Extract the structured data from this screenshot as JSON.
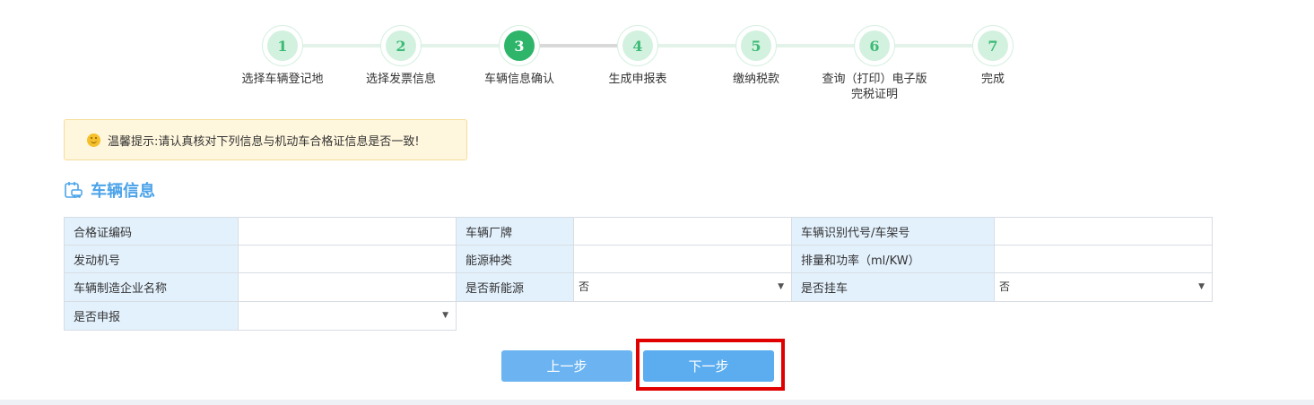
{
  "steps": [
    {
      "num": "1",
      "label": "选择车辆登记地"
    },
    {
      "num": "2",
      "label": "选择发票信息"
    },
    {
      "num": "3",
      "label": "车辆信息确认"
    },
    {
      "num": "4",
      "label": "生成申报表"
    },
    {
      "num": "5",
      "label": "缴纳税款"
    },
    {
      "num": "6",
      "label": "查询（打印）电子版完税证明"
    },
    {
      "num": "7",
      "label": "完成"
    }
  ],
  "active_step": 3,
  "tip": {
    "text": "温馨提示:请认真核对下列信息与机动车合格证信息是否一致!"
  },
  "section": {
    "title": "车辆信息"
  },
  "form": {
    "cert_no_label": "合格证编码",
    "cert_no_value": "",
    "brand_label": "车辆厂牌",
    "brand_value": "",
    "vin_label": "车辆识别代号/车架号",
    "vin_value": "",
    "engine_label": "发动机号",
    "engine_value": "",
    "energy_label": "能源种类",
    "energy_value": "",
    "displacement_label": "排量和功率（ml/KW）",
    "displacement_value": "",
    "manufacturer_label": "车辆制造企业名称",
    "manufacturer_value": "",
    "new_energy_label": "是否新能源",
    "new_energy_value": "否",
    "trailer_label": "是否挂车",
    "trailer_value": "否",
    "declare_label": "是否申报",
    "declare_value": ""
  },
  "buttons": {
    "prev": "上一步",
    "next": "下一步"
  },
  "colors": {
    "accent_green": "#2eb56a",
    "accent_blue": "#5badf0",
    "highlight_red": "#e00000"
  }
}
